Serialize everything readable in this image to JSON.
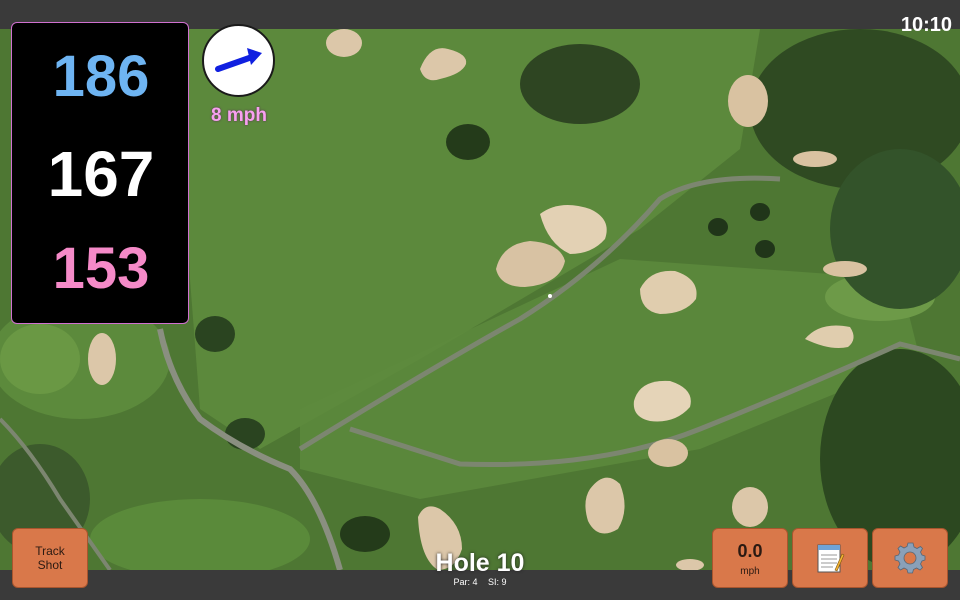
{
  "status": {
    "time": "10:10"
  },
  "distances": {
    "back": "186",
    "middle": "167",
    "front": "153"
  },
  "wind": {
    "speed_text": "8 mph",
    "direction": "east-northeast",
    "arrow_color": "#1020e0"
  },
  "buttons": {
    "track_shot_line1": "Track",
    "track_shot_line2": "Shot",
    "speed_value": "0.0",
    "speed_unit": "mph",
    "notes_icon": "notepad-icon",
    "settings_icon": "gear-icon"
  },
  "hole": {
    "title": "Hole 10",
    "par": "Par: 4",
    "si": "SI: 9"
  },
  "colors": {
    "back": "#6eb4f2",
    "middle": "#ffffff",
    "front": "#f58ac8",
    "button": "#d9784a",
    "panel_border": "#d070d0"
  }
}
